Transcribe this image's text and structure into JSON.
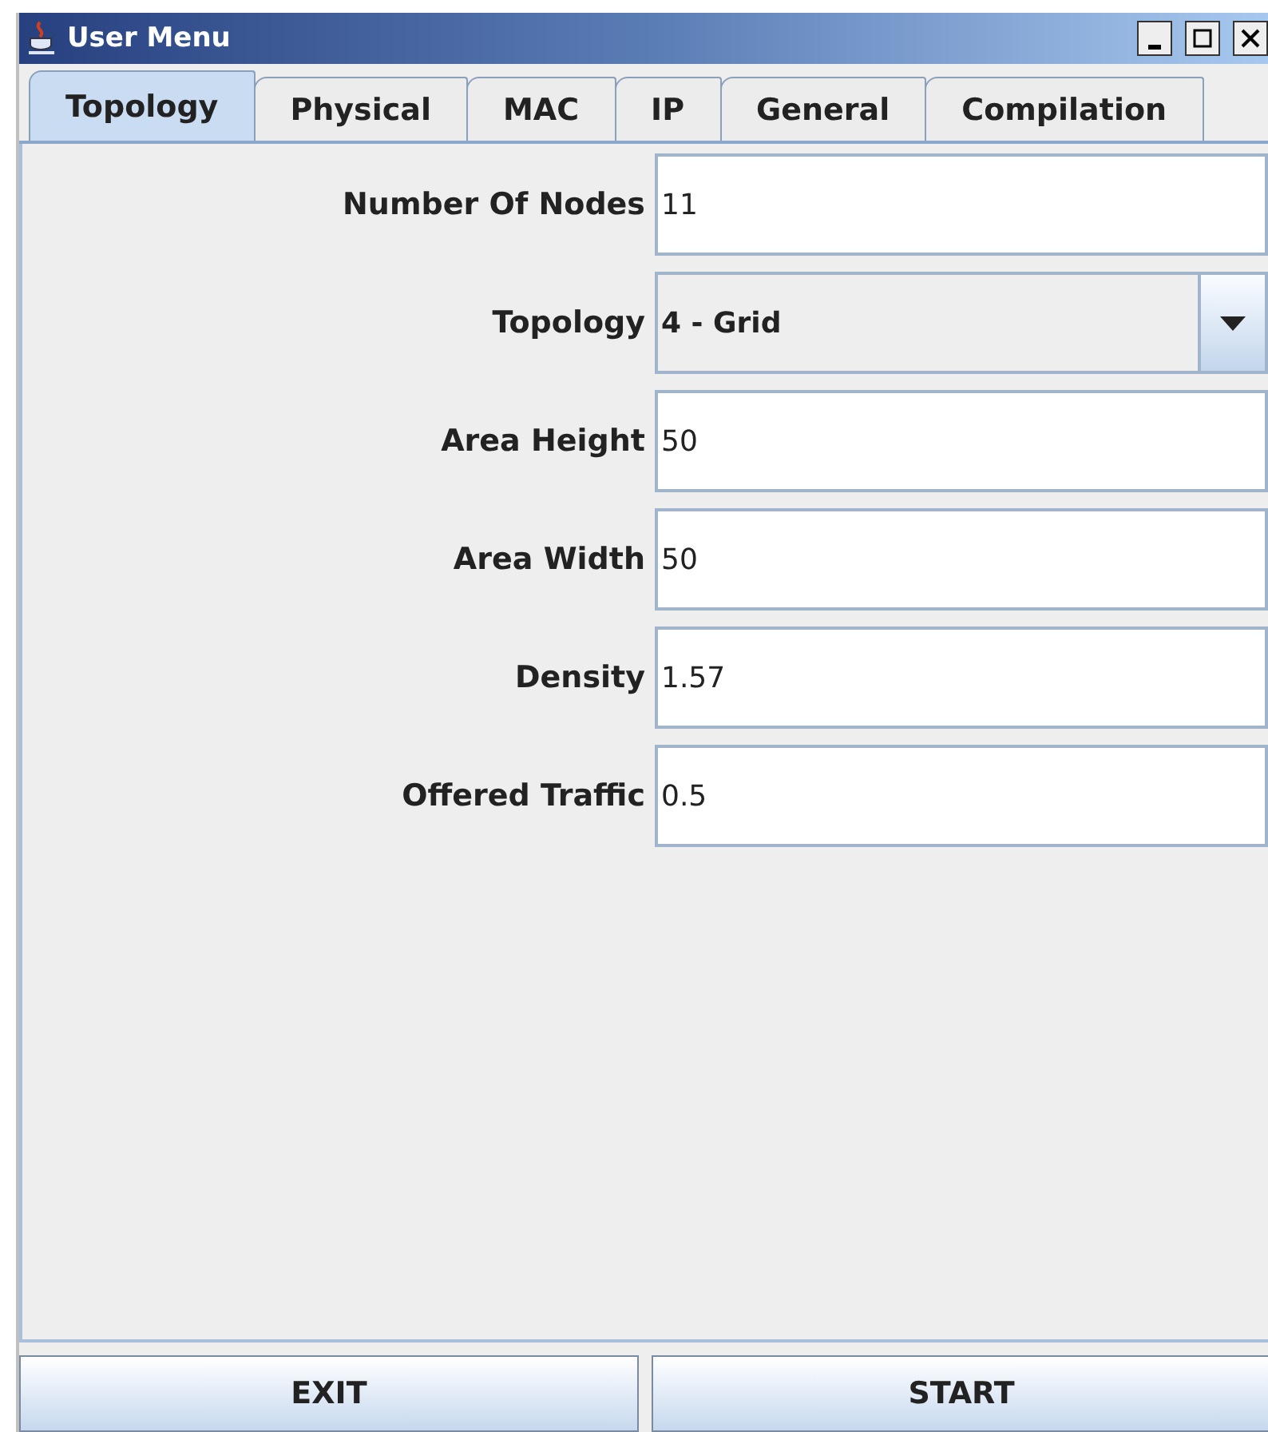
{
  "window": {
    "title": "User Menu"
  },
  "tabs": [
    {
      "label": "Topology",
      "selected": true
    },
    {
      "label": "Physical",
      "selected": false
    },
    {
      "label": "MAC",
      "selected": false
    },
    {
      "label": "IP",
      "selected": false
    },
    {
      "label": "General",
      "selected": false
    },
    {
      "label": "Compilation",
      "selected": false
    }
  ],
  "fields": [
    {
      "kind": "text",
      "label": "Number Of Nodes",
      "value": "11"
    },
    {
      "kind": "select",
      "label": "Topology",
      "value": "4 - Grid"
    },
    {
      "kind": "text",
      "label": "Area Height",
      "value": "50"
    },
    {
      "kind": "text",
      "label": "Area Width",
      "value": "50"
    },
    {
      "kind": "text",
      "label": "Density",
      "value": "1.57"
    },
    {
      "kind": "text",
      "label": "Offered Traffic",
      "value": "0.5"
    }
  ],
  "buttons": [
    "EXIT",
    "START"
  ]
}
